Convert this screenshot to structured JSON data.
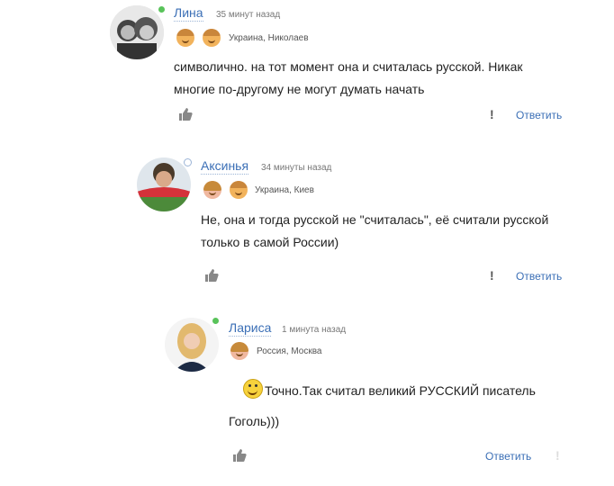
{
  "comments": [
    {
      "author": "Лина",
      "time": "35 минут назад",
      "location": "Украина, Николаев",
      "text_line1": "символично. на тот момент она и считалась русской. Никак",
      "text_line2": "многие по-другому не могут думать начать",
      "reply_label": "Ответить",
      "report_label": "!",
      "online_color": "#59c35a"
    },
    {
      "author": "Аксинья",
      "time": "34 минуты назад",
      "location": "Украина, Киев",
      "text_line1": "Не, она и тогда русской не \"считалась\", её считали русской",
      "text_line2": "только в самой России)",
      "reply_label": "Ответить",
      "report_label": "!",
      "online_color": "#9bb4d6"
    },
    {
      "author": "Лариса",
      "time": "1 минута назад",
      "location": "Россия, Москва",
      "text_line1": "Точно.Так считал великий РУССКИЙ писатель",
      "text_line2": "Гоголь)))",
      "reply_label": "Ответить",
      "report_label": "!",
      "online_color": "#59c35a"
    }
  ],
  "icons": {
    "like": "thumbs-up-icon",
    "emoticon": "laughing-smiley-icon"
  }
}
